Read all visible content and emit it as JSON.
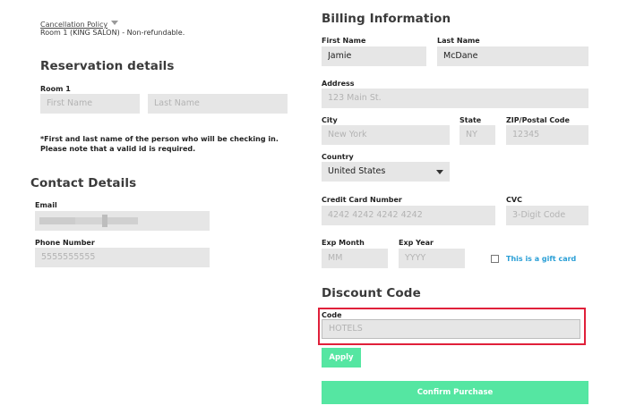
{
  "left": {
    "cancellation_policy": "Cancellation Policy",
    "room_note": "Room 1 (KING SALON) - Non-refundable.",
    "reservation_title": "Reservation details",
    "room_label": "Room 1",
    "first_name_placeholder": "First Name",
    "last_name_placeholder": "Last Name",
    "checkin_note": "*First and last name of the person who will be checking in. Please note that a valid id is required.",
    "contact_title": "Contact Details",
    "email_label": "Email",
    "phone_label": "Phone Number",
    "phone_placeholder": "5555555555"
  },
  "billing": {
    "title": "Billing Information",
    "first_name_label": "First Name",
    "first_name_value": "Jamie",
    "last_name_label": "Last Name",
    "last_name_value": "McDane",
    "address_label": "Address",
    "address_placeholder": "123 Main St.",
    "city_label": "City",
    "city_placeholder": "New York",
    "state_label": "State",
    "state_placeholder": "NY",
    "zip_label": "ZIP/Postal Code",
    "zip_placeholder": "12345",
    "country_label": "Country",
    "country_value": "United States",
    "cc_label": "Credit Card Number",
    "cc_placeholder": "4242 4242 4242 4242",
    "cvc_label": "CVC",
    "cvc_placeholder": "3-Digit Code",
    "exp_month_label": "Exp Month",
    "exp_month_placeholder": "MM",
    "exp_year_label": "Exp Year",
    "exp_year_placeholder": "YYYY",
    "gift_card_label": "This is a gift card"
  },
  "discount": {
    "title": "Discount Code",
    "code_label": "Code",
    "code_placeholder": "HOTELS",
    "apply_label": "Apply"
  },
  "confirm_label": "Confirm Purchase",
  "colors": {
    "accent": "#55e6a2",
    "highlight": "#e0203a",
    "gift_link": "#2a9fd6"
  }
}
